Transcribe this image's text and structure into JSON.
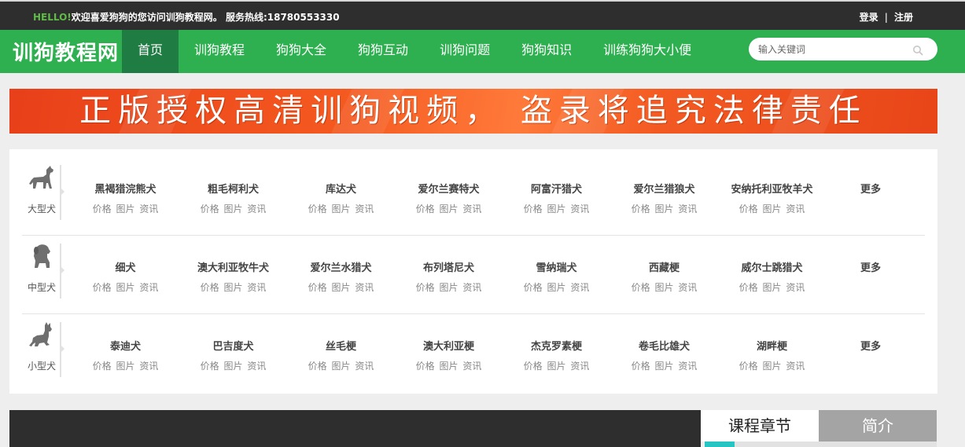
{
  "topbar": {
    "hello": "HELLO!",
    "welcome": "欢迎喜爱狗狗的您访问训狗教程网。 服务热线:18780553330",
    "login": "登录",
    "separator": "|",
    "register": "注册"
  },
  "header": {
    "logo": "训狗教程网",
    "nav": [
      "首页",
      "训狗教程",
      "狗狗大全",
      "狗狗互动",
      "训狗问题",
      "狗狗知识",
      "训练狗狗大小便"
    ],
    "active_index": 0,
    "search_placeholder": "输入关键词"
  },
  "banner": {
    "text": "正版授权高清训狗视频， 盗录将追究法律责任"
  },
  "breeds": {
    "link_labels": [
      "价格",
      "图片",
      "资讯"
    ],
    "more_label": "更多",
    "categories": [
      {
        "label": "大型犬",
        "icon": "large-dog-icon",
        "items": [
          "黑褐猎浣熊犬",
          "粗毛柯利犬",
          "库达犬",
          "爱尔兰赛特犬",
          "阿富汗猎犬",
          "爱尔兰猎狼犬",
          "安纳托利亚牧羊犬"
        ]
      },
      {
        "label": "中型犬",
        "icon": "medium-dog-icon",
        "items": [
          "细犬",
          "澳大利亚牧牛犬",
          "爱尔兰水猎犬",
          "布列塔尼犬",
          "雪纳瑞犬",
          "西藏梗",
          "威尔士跳猎犬"
        ]
      },
      {
        "label": "小型犬",
        "icon": "small-dog-icon",
        "items": [
          "泰迪犬",
          "巴吉度犬",
          "丝毛梗",
          "澳大利亚梗",
          "杰克罗素梗",
          "卷毛比雄犬",
          "湖畔梗"
        ]
      }
    ]
  },
  "tabs": [
    "课程章节",
    "简介"
  ],
  "colors": {
    "nav_green": "#2eb050",
    "nav_active": "#1f7d44",
    "banner_orange": "#f4581f",
    "accent_teal": "#27c4c4"
  }
}
